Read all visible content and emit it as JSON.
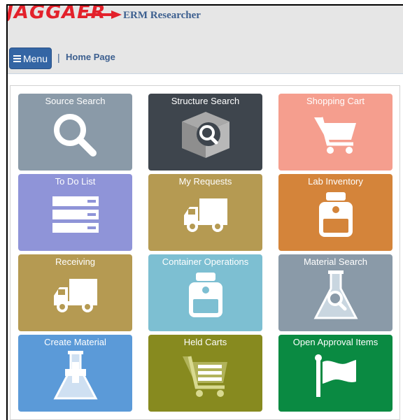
{
  "header": {
    "logo_text": "JAGGAER",
    "app_title": "ERM Researcher",
    "menu_label": "Menu",
    "breadcrumb_separator": "|",
    "breadcrumb": "Home Page"
  },
  "colors": {
    "logo_red": "#e3212b",
    "title_blue": "#3c5f8f",
    "menu_button": "#3465a4"
  },
  "tiles": [
    {
      "label": "Source Search",
      "icon": "search-icon",
      "color": "#8a9aa8"
    },
    {
      "label": "Structure Search",
      "icon": "box-search-icon",
      "color": "#3e454d"
    },
    {
      "label": "Shopping Cart",
      "icon": "shopping-cart-icon",
      "color": "#f59e8e"
    },
    {
      "label": "To Do List",
      "icon": "list-icon",
      "color": "#8f94d8"
    },
    {
      "label": "My Requests",
      "icon": "truck-icon",
      "color": "#b59a52"
    },
    {
      "label": "Lab Inventory",
      "icon": "bottle-icon",
      "color": "#d4843a"
    },
    {
      "label": "Receiving",
      "icon": "truck-icon",
      "color": "#b59a52"
    },
    {
      "label": "Container Operations",
      "icon": "bottle-icon",
      "color": "#7dbfd2"
    },
    {
      "label": "Material Search",
      "icon": "flask-search-icon",
      "color": "#8a9aa8"
    },
    {
      "label": "Create Material",
      "icon": "flask-plus-icon",
      "color": "#5b9ad8"
    },
    {
      "label": "Held Carts",
      "icon": "list-cart-icon",
      "color": "#878a1f"
    },
    {
      "label": "Open Approval Items",
      "icon": "flag-icon",
      "color": "#0a8a42"
    }
  ]
}
